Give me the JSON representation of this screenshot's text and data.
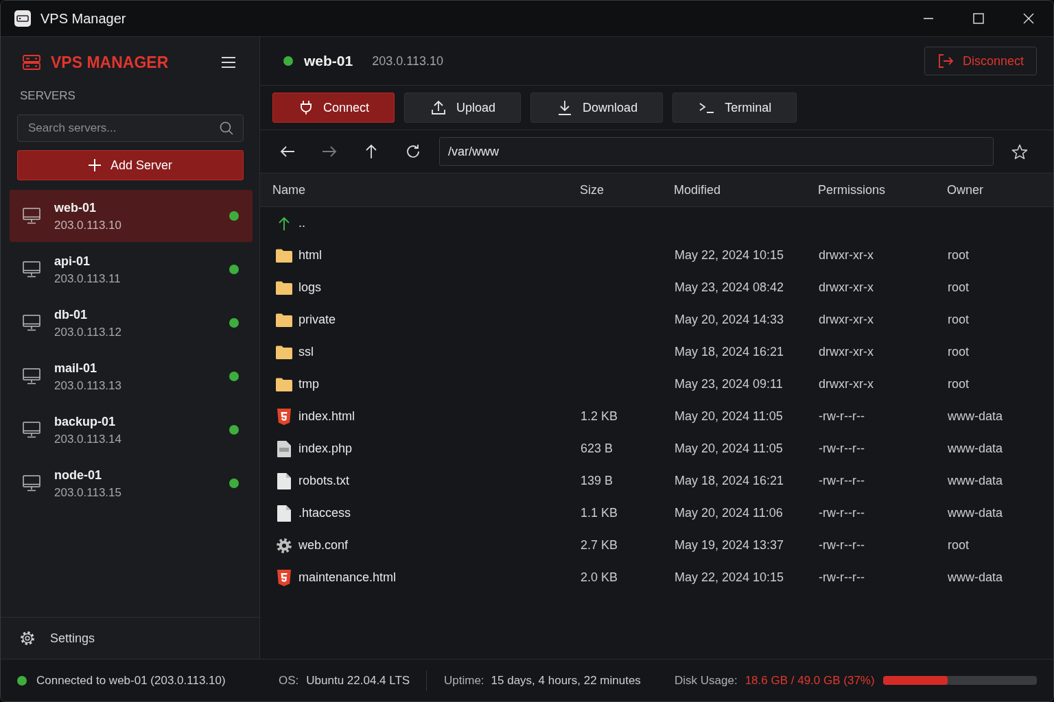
{
  "window": {
    "title": "VPS Manager"
  },
  "sidebar": {
    "brand": "VPS MANAGER",
    "section_label": "SERVERS",
    "search": {
      "placeholder": "Search servers..."
    },
    "add_button": "Add Server",
    "servers": [
      {
        "name": "web-01",
        "ip": "203.0.113.10",
        "online": true,
        "selected": true
      },
      {
        "name": "api-01",
        "ip": "203.0.113.11",
        "online": true,
        "selected": false
      },
      {
        "name": "db-01",
        "ip": "203.0.113.12",
        "online": true,
        "selected": false
      },
      {
        "name": "mail-01",
        "ip": "203.0.113.13",
        "online": true,
        "selected": false
      },
      {
        "name": "backup-01",
        "ip": "203.0.113.14",
        "online": true,
        "selected": false
      },
      {
        "name": "node-01",
        "ip": "203.0.113.15",
        "online": true,
        "selected": false
      }
    ],
    "settings": "Settings"
  },
  "header": {
    "server_name": "web-01",
    "ip": "203.0.113.10",
    "online": true,
    "disconnect": "Disconnect"
  },
  "toolbar": [
    {
      "kind": "connect",
      "label": "Connect",
      "primary": true
    },
    {
      "kind": "upload",
      "label": "Upload",
      "primary": false
    },
    {
      "kind": "download",
      "label": "Download",
      "primary": false
    },
    {
      "kind": "terminal",
      "label": "Terminal",
      "primary": false
    }
  ],
  "navigation": {
    "buttons": [
      {
        "kind": "back",
        "disabled": false
      },
      {
        "kind": "forward",
        "disabled": true
      },
      {
        "kind": "up",
        "disabled": false
      },
      {
        "kind": "refresh",
        "disabled": false
      }
    ],
    "path": "/var/www",
    "bookmarked": false
  },
  "table": {
    "columns": [
      "Name",
      "Size",
      "Modified",
      "Permissions",
      "Owner"
    ],
    "rows": [
      {
        "kind": "parent",
        "name": ".."
      },
      {
        "kind": "folder",
        "name": "html",
        "modified": "May 22, 2024 10:15",
        "permissions": "drwxr-xr-x",
        "owner": "root"
      },
      {
        "kind": "folder",
        "name": "logs",
        "modified": "May 23, 2024 08:42",
        "permissions": "drwxr-xr-x",
        "owner": "root"
      },
      {
        "kind": "folder",
        "name": "private",
        "modified": "May 20, 2024 14:33",
        "permissions": "drwxr-xr-x",
        "owner": "root"
      },
      {
        "kind": "folder",
        "name": "ssl",
        "modified": "May 18, 2024 16:21",
        "permissions": "drwxr-xr-x",
        "owner": "root"
      },
      {
        "kind": "folder",
        "name": "tmp",
        "modified": "May 23, 2024 09:11",
        "permissions": "drwxr-xr-x",
        "owner": "root"
      },
      {
        "kind": "html",
        "name": "index.html",
        "size": "1.2 KB",
        "modified": "May 20, 2024 11:05",
        "permissions": "-rw-r--r--",
        "owner": "www-data"
      },
      {
        "kind": "php",
        "name": "index.php",
        "size": "623 B",
        "modified": "May 20, 2024 11:05",
        "permissions": "-rw-r--r--",
        "owner": "www-data"
      },
      {
        "kind": "text",
        "name": "robots.txt",
        "size": "139 B",
        "modified": "May 18, 2024 16:21",
        "permissions": "-rw-r--r--",
        "owner": "www-data"
      },
      {
        "kind": "text",
        "name": ".htaccess",
        "size": "1.1 KB",
        "modified": "May 20, 2024 11:06",
        "permissions": "-rw-r--r--",
        "owner": "www-data"
      },
      {
        "kind": "config",
        "name": "web.conf",
        "size": "2.7 KB",
        "modified": "May 19, 2024 13:37",
        "permissions": "-rw-r--r--",
        "owner": "root"
      },
      {
        "kind": "html",
        "name": "maintenance.html",
        "size": "2.0 KB",
        "modified": "May 22, 2024 10:15",
        "permissions": "-rw-r--r--",
        "owner": "www-data"
      }
    ]
  },
  "status_bar": {
    "connection": {
      "online": true,
      "text": "Connected to web-01 (203.0.113.10)"
    },
    "os": {
      "label": "OS:",
      "value": "Ubuntu 22.04.4 LTS"
    },
    "uptime": {
      "label": "Uptime:",
      "value": "15 days, 4 hours, 22 minutes"
    },
    "disk": {
      "label": "Disk Usage:",
      "value": "18.6 GB / 49.0 GB (37%)",
      "level": 0.42
    }
  }
}
